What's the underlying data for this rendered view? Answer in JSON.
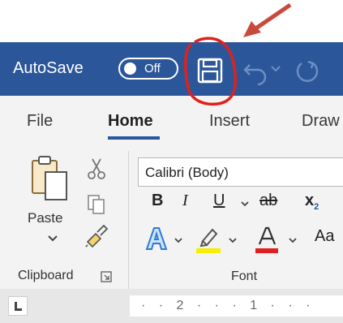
{
  "titlebar": {
    "autosave_label": "AutoSave",
    "toggle_state": "Off",
    "accent_color": "#2b579a"
  },
  "tabs": [
    {
      "label": "File"
    },
    {
      "label": "Home",
      "active": true
    },
    {
      "label": "Insert"
    },
    {
      "label": "Draw"
    }
  ],
  "clipboard": {
    "paste_label": "Paste",
    "group_label": "Clipboard"
  },
  "font": {
    "font_name": "Calibri (Body)",
    "bold": "B",
    "italic": "I",
    "underline": "U",
    "strikethrough": "ab",
    "subscript_base": "x",
    "subscript_mark": "2",
    "grow_shrink": "Aa",
    "group_label": "Font",
    "highlight_color": "#f5f000",
    "font_color": "#e02020"
  },
  "ruler": {
    "text": "· · 2 · · · 1 · · ·"
  },
  "annotation": {
    "color": "#e0201a",
    "arrow_color": "#c84a3c"
  },
  "icons": [
    "save-icon",
    "undo-icon",
    "redo-icon",
    "paste-icon",
    "cut-icon",
    "copy-icon",
    "format-painter-icon",
    "text-effects-icon",
    "highlight-icon",
    "font-color-icon",
    "dialog-launcher-icon"
  ]
}
